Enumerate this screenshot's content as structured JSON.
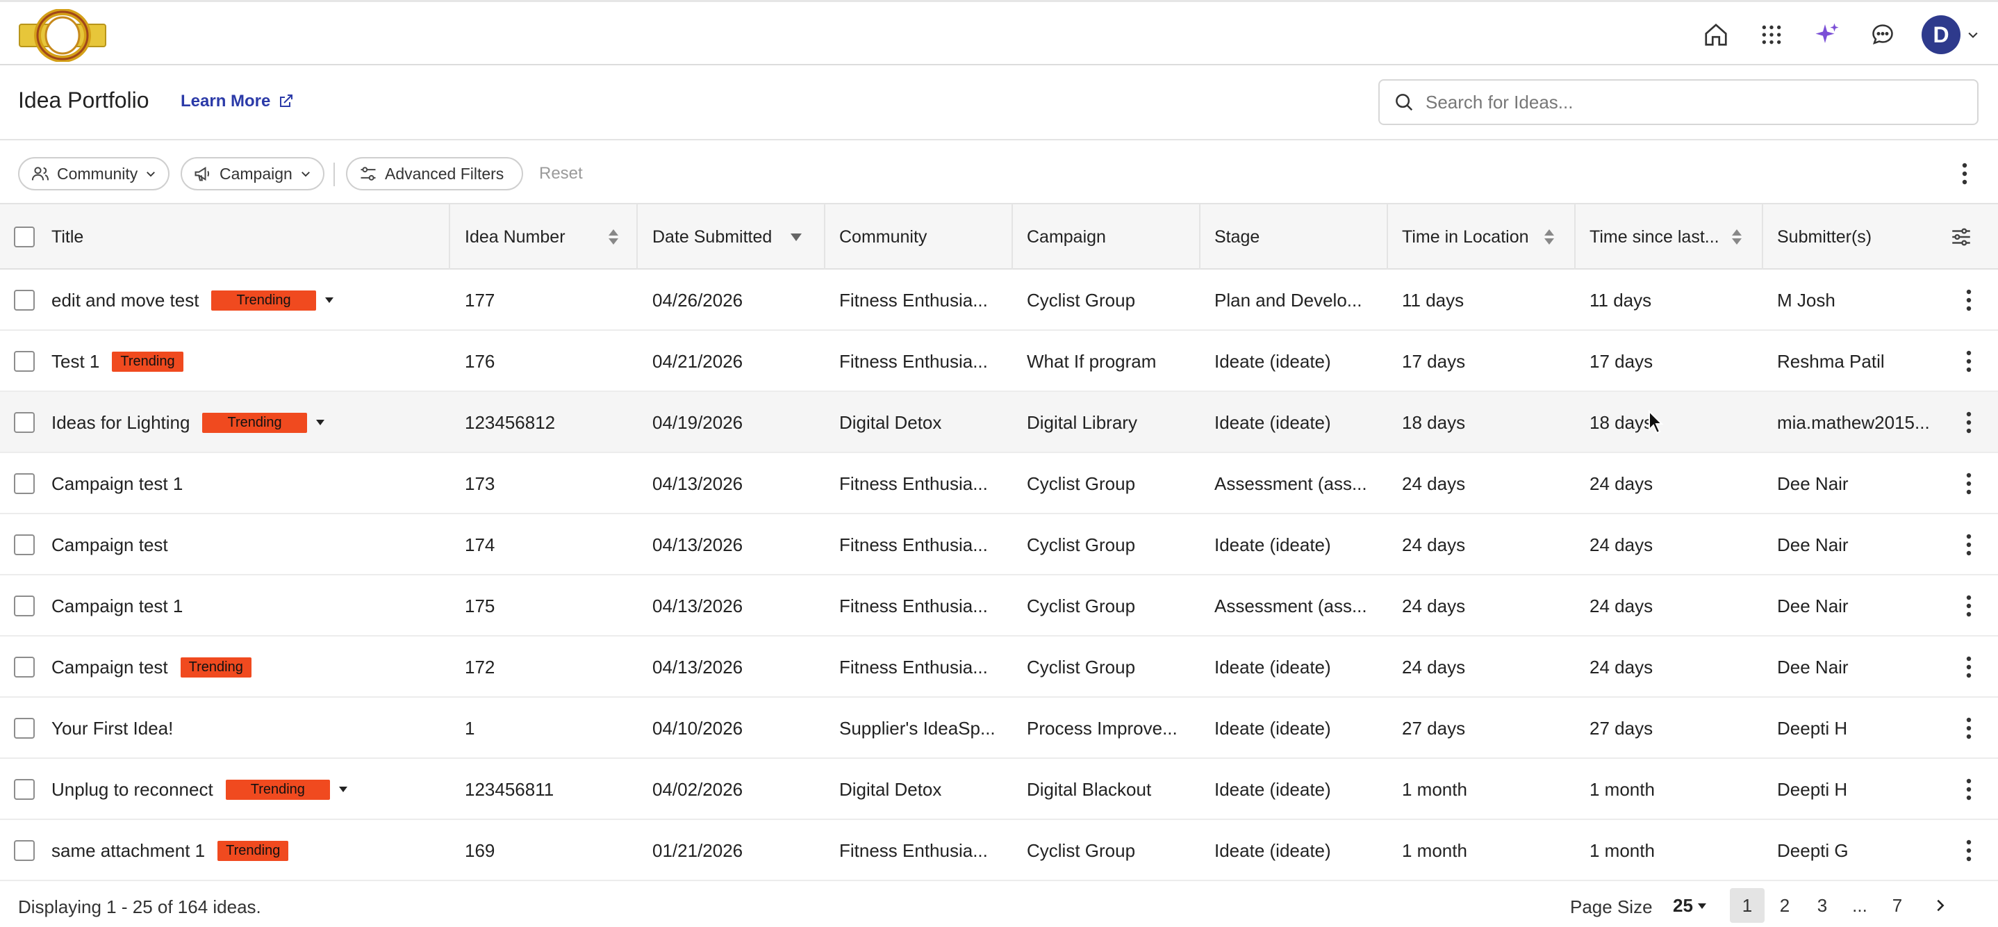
{
  "nav": {
    "icons": [
      "home-icon",
      "apps-grid-icon",
      "ai-sparkle-icon",
      "chat-icon"
    ],
    "avatar_initial": "D"
  },
  "header": {
    "title": "Idea Portfolio",
    "learn_more": "Learn More",
    "search_placeholder": "Search for Ideas..."
  },
  "filters": {
    "community": "Community",
    "campaign": "Campaign",
    "advanced": "Advanced Filters",
    "reset": "Reset"
  },
  "columns": {
    "title": "Title",
    "idea_number": "Idea Number",
    "date_submitted": "Date Submitted",
    "community": "Community",
    "campaign": "Campaign",
    "stage": "Stage",
    "time_in_location": "Time in Location",
    "time_since_last": "Time since last...",
    "submitters": "Submitter(s)"
  },
  "rows": [
    {
      "title": "edit and move test",
      "badge": "Trending",
      "number": "177",
      "date": "04/26/2026",
      "community": "Fitness Enthusia...",
      "campaign": "Cyclist Group",
      "stage": "Plan and Develo...",
      "time_loc": "11 days",
      "time_last": "11 days",
      "submitter": "M Josh"
    },
    {
      "title": "Test 1",
      "badge": "Trending",
      "number": "176",
      "date": "04/21/2026",
      "community": "Fitness Enthusia...",
      "campaign": "What If program",
      "stage": "Ideate (ideate)",
      "time_loc": "17 days",
      "time_last": "17 days",
      "submitter": "Reshma Patil"
    },
    {
      "title": "Ideas for Lighting",
      "badge": "Trending",
      "number": "123456812",
      "date": "04/19/2026",
      "community": "Digital Detox",
      "campaign": "Digital Library",
      "stage": "Ideate (ideate)",
      "time_loc": "18 days",
      "time_last": "18 days",
      "submitter": "mia.mathew2015..."
    },
    {
      "title": "Campaign test 1",
      "badge": "",
      "number": "173",
      "date": "04/13/2026",
      "community": "Fitness Enthusia...",
      "campaign": "Cyclist Group",
      "stage": "Assessment (ass...",
      "time_loc": "24 days",
      "time_last": "24 days",
      "submitter": "Dee Nair"
    },
    {
      "title": "Campaign test",
      "badge": "",
      "number": "174",
      "date": "04/13/2026",
      "community": "Fitness Enthusia...",
      "campaign": "Cyclist Group",
      "stage": "Ideate (ideate)",
      "time_loc": "24 days",
      "time_last": "24 days",
      "submitter": "Dee Nair"
    },
    {
      "title": "Campaign test 1",
      "badge": "",
      "number": "175",
      "date": "04/13/2026",
      "community": "Fitness Enthusia...",
      "campaign": "Cyclist Group",
      "stage": "Assessment (ass...",
      "time_loc": "24 days",
      "time_last": "24 days",
      "submitter": "Dee Nair"
    },
    {
      "title": "Campaign test",
      "badge": "Trending",
      "number": "172",
      "date": "04/13/2026",
      "community": "Fitness Enthusia...",
      "campaign": "Cyclist Group",
      "stage": "Ideate (ideate)",
      "time_loc": "24 days",
      "time_last": "24 days",
      "submitter": "Dee Nair"
    },
    {
      "title": "Your First Idea!",
      "badge": "",
      "number": "1",
      "date": "04/10/2026",
      "community": "Supplier's IdeaSp...",
      "campaign": "Process Improve...",
      "stage": "Ideate (ideate)",
      "time_loc": "27 days",
      "time_last": "27 days",
      "submitter": "Deepti H"
    },
    {
      "title": "Unplug to reconnect",
      "badge": "Trending",
      "number": "123456811",
      "date": "04/02/2026",
      "community": "Digital Detox",
      "campaign": "Digital Blackout",
      "stage": "Ideate (ideate)",
      "time_loc": "1 month",
      "time_last": "1 month",
      "submitter": "Deepti H"
    },
    {
      "title": "same attachment 1",
      "badge": "Trending",
      "number": "169",
      "date": "01/21/2026",
      "community": "Fitness Enthusia...",
      "campaign": "Cyclist Group",
      "stage": "Ideate (ideate)",
      "time_loc": "1 month",
      "time_last": "1 month",
      "submitter": "Deepti G"
    }
  ],
  "footer": {
    "displaying": "Displaying 1 - 25 of 164 ideas.",
    "page_size_label": "Page Size",
    "page_size": "25",
    "pages": [
      "1",
      "2",
      "3",
      "...",
      "7"
    ],
    "current_page": "1"
  },
  "colors": {
    "badge": "#f04a1f",
    "link": "#2b3aa8",
    "avatar": "#2e3a8c",
    "sparkle": "#7b4fd6"
  }
}
